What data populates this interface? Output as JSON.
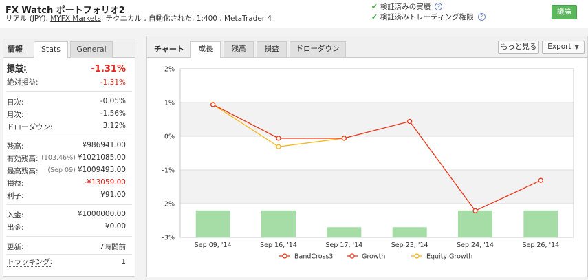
{
  "header": {
    "title": "FX Watch ポートフォリオ2",
    "account": "リアル (JPY),",
    "broker": "MYFX Markets",
    "details": ", テクニカル , 自動化された, 1:400 , MetaTrader 4",
    "verified_track": "検証済みの実績",
    "verified_trading": "検証済みトレーディング権限",
    "discuss_label": "議論",
    "help_glyph": "?"
  },
  "left": {
    "heading": "情報",
    "tabs": [
      "Stats",
      "General"
    ],
    "profit_label": "損益:",
    "profit_value": "-1.31%",
    "abs_label": "絶対損益:",
    "abs_value": "-1.31%",
    "daily_label": "日次:",
    "daily_value": "-0.05%",
    "monthly_label": "月次:",
    "monthly_value": "-1.56%",
    "dd_label": "ドローダウン:",
    "dd_value": "3.12%",
    "balance_label": "残高:",
    "balance_value": "¥986941.00",
    "equity_label": "有効残高:",
    "equity_note": "(103.46%)",
    "equity_value": "¥1021085.00",
    "highest_label": "最高残高:",
    "highest_note": "(Sep 09)",
    "highest_value": "¥1009493.00",
    "pl_label": "損益:",
    "pl_value": "-¥13059.00",
    "interest_label": "利子:",
    "interest_value": "¥91.00",
    "deposit_label": "入金:",
    "deposit_value": "¥1000000.00",
    "withdraw_label": "出金:",
    "withdraw_value": "¥0.00",
    "updated_label": "更新:",
    "updated_value": "7時間前",
    "tracking_label": "トラッキング:",
    "tracking_value": "1"
  },
  "right": {
    "heading": "チャート",
    "tabs": [
      "成長",
      "残高",
      "損益",
      "ドローダウン"
    ],
    "more_label": "もっと見る",
    "export_label": "Export",
    "caret": "▼"
  },
  "chart_data": {
    "type": "line",
    "categories": [
      "Sep 09, '14",
      "Sep 16, '14",
      "Sep 17, '14",
      "Sep 23, '14",
      "Sep 24, '14",
      "Sep 26, '14"
    ],
    "ylim": [
      -3,
      2
    ],
    "yticks": [
      "2%",
      "1%",
      "0%",
      "-1%",
      "-2%",
      "-3%"
    ],
    "ytick_values": [
      2,
      1,
      0,
      -1,
      -2,
      -3
    ],
    "series": [
      {
        "name": "BandCross3",
        "type": "bar",
        "color": "#a6dca6",
        "values": [
          -2.2,
          -2.2,
          -2.7,
          -2.7,
          -2.2,
          -2.2
        ]
      },
      {
        "name": "Growth",
        "type": "line",
        "color": "#e8391c",
        "values": [
          0.94,
          -0.06,
          -0.06,
          0.44,
          -2.21,
          -1.31
        ]
      },
      {
        "name": "Equity Growth",
        "type": "line",
        "color": "#f7b81d",
        "values": [
          0.94,
          -0.31,
          -0.06,
          null,
          null,
          null
        ]
      }
    ],
    "legend": [
      "BandCross3",
      "Growth",
      "Equity Growth"
    ],
    "legend_position": "bottom",
    "grid": true
  }
}
